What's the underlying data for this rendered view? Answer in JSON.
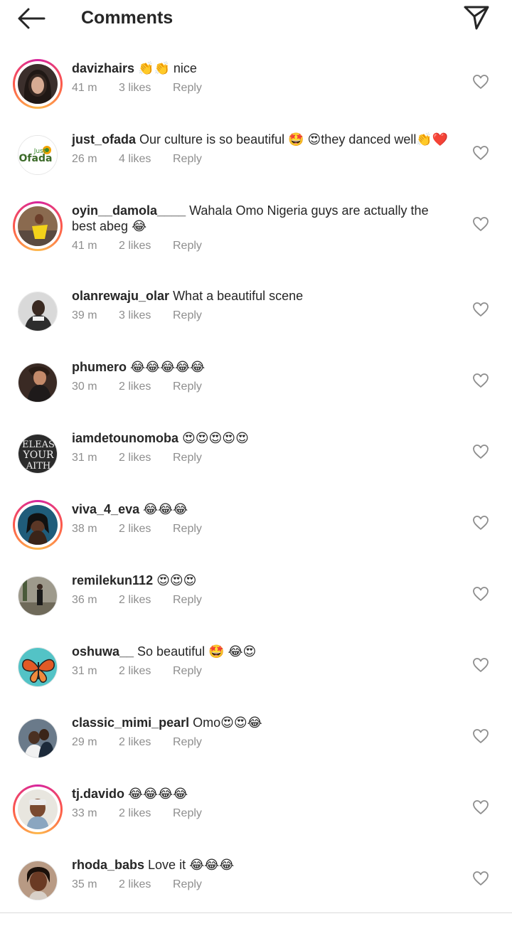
{
  "header": {
    "title": "Comments"
  },
  "comments": [
    {
      "user": "davizhairs",
      "text": "👏👏 nice",
      "time": "41 m",
      "likes": "3 likes",
      "reply": "Reply",
      "story": true
    },
    {
      "user": "just_ofada",
      "text": "Our culture is so beautiful 🤩 😍they danced well👏❤️",
      "time": "26 m",
      "likes": "4 likes",
      "reply": "Reply",
      "story": false
    },
    {
      "user": "oyin__damola____",
      "text": "Wahala Omo Nigeria guys are actually the best abeg 😂",
      "time": "41 m",
      "likes": "2 likes",
      "reply": "Reply",
      "story": true
    },
    {
      "user": "olanrewaju_olar",
      "text": "What a beautiful scene",
      "time": "39 m",
      "likes": "3 likes",
      "reply": "Reply",
      "story": false
    },
    {
      "user": "phumero",
      "text": "😂😂😂😂😂",
      "time": "30 m",
      "likes": "2 likes",
      "reply": "Reply",
      "story": false
    },
    {
      "user": "iamdetounomoba",
      "text": "😍😍😍😍😍",
      "time": "31 m",
      "likes": "2 likes",
      "reply": "Reply",
      "story": false
    },
    {
      "user": "viva_4_eva",
      "text": "😂😂😂",
      "time": "38 m",
      "likes": "2 likes",
      "reply": "Reply",
      "story": true
    },
    {
      "user": "remilekun112",
      "text": "😍😍😍",
      "time": "36 m",
      "likes": "2 likes",
      "reply": "Reply",
      "story": false
    },
    {
      "user": "oshuwa__",
      "text": "So beautiful 🤩 😂😍",
      "time": "31 m",
      "likes": "2 likes",
      "reply": "Reply",
      "story": false
    },
    {
      "user": "classic_mimi_pearl",
      "text": "Omo😍😍😂",
      "time": "29 m",
      "likes": "2 likes",
      "reply": "Reply",
      "story": false
    },
    {
      "user": "tj.davido",
      "text": "😂😂😂😂",
      "time": "33 m",
      "likes": "2 likes",
      "reply": "Reply",
      "story": true
    },
    {
      "user": "rhoda_babs",
      "text": "Love it 😂😂😂",
      "time": "35 m",
      "likes": "2 likes",
      "reply": "Reply",
      "story": false
    }
  ],
  "avatars": {
    "logo_text_top": "Just",
    "logo_text_bottom": "Ofada",
    "faith_line1": "ELEAS",
    "faith_line2": "YOUR",
    "faith_line3": "AITH"
  },
  "icons": {
    "back": "arrow-left-icon",
    "send": "paper-plane-icon",
    "like": "heart-outline-icon"
  },
  "colors": {
    "text": "#262626",
    "meta": "#8e8e8e",
    "story_ring": "#d6249f"
  }
}
